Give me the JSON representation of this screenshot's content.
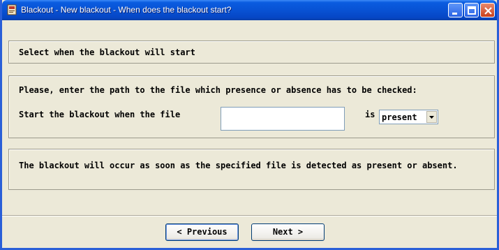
{
  "window": {
    "title": "Blackout - New blackout - When does the blackout start?",
    "title_icon": "app-icon"
  },
  "section_header": {
    "text": "Select when the blackout will start"
  },
  "file_section": {
    "instruction": "Please, enter the path to the file which presence or absence has to be checked:",
    "start_label": "Start the blackout when the file",
    "file_path_value": "",
    "is_label": "is",
    "condition_selected": "present"
  },
  "info_section": {
    "text": "The blackout will occur as soon as the specified file is detected as present or absent."
  },
  "footer": {
    "previous_label": "< Previous",
    "next_label": "Next >"
  },
  "colors": {
    "titlebar": "#0852d4",
    "window_bg": "#ece9d8",
    "close_button": "#c9401c"
  }
}
